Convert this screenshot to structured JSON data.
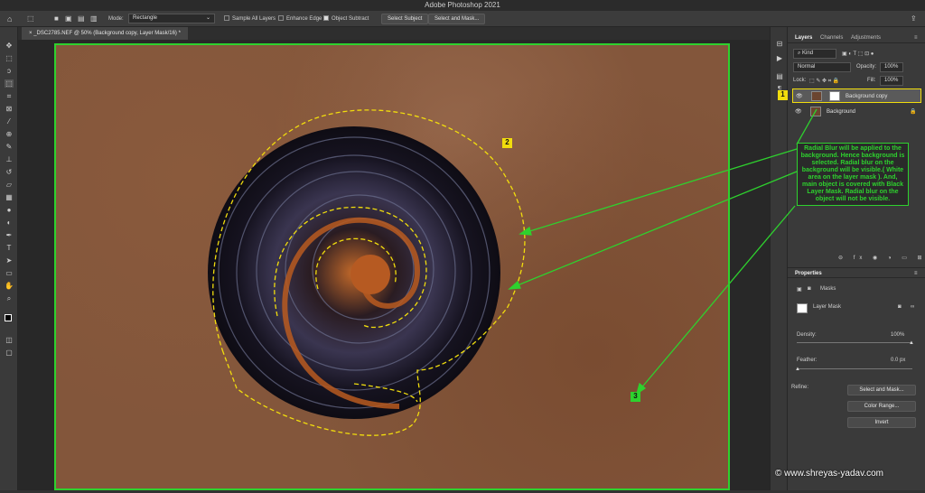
{
  "app": {
    "title": "Adobe Photoshop 2021"
  },
  "options_bar": {
    "mode_label": "Mode:",
    "mode_value": "Rectangle",
    "sample_all_layers": "Sample All Layers",
    "enhance_edge": "Enhance Edge",
    "object_subtract": "Object Subtract",
    "select_subject": "Select Subject",
    "select_and_mask": "Select and Mask..."
  },
  "document": {
    "tab_title": "_DSC2785.NEF @ 50% (Background copy, Layer Mask/16) *"
  },
  "layers_panel": {
    "tabs": [
      "Layers",
      "Channels",
      "Adjustments"
    ],
    "filter_kind": "Kind",
    "blend_mode": "Normal",
    "opacity_label": "Opacity:",
    "opacity_value": "100%",
    "lock_label": "Lock:",
    "fill_label": "Fill:",
    "fill_value": "100%",
    "layers": [
      {
        "name": "Background copy",
        "selected": true
      },
      {
        "name": "Background",
        "selected": false
      }
    ]
  },
  "properties_panel": {
    "title": "Properties",
    "section": "Masks",
    "mask_type": "Layer Mask",
    "density_label": "Density:",
    "density_value": "100%",
    "feather_label": "Feather:",
    "feather_value": "0.0 px",
    "refine_label": "Refine:",
    "select_and_mask": "Select and Mask...",
    "color_range": "Color Range...",
    "invert": "Invert"
  },
  "annotations": {
    "markers": [
      "1",
      "2",
      "3"
    ],
    "note": "Radial Blur will be applied to the background. Hence background is selected. Radial blur on the background will be visible.( White area on the layer mask ). And, main object is covered with Black Layer Mask. Radial blur on the object will not be visible.",
    "accent_green": "#2ed12e",
    "marker_yellow": "#f1dd0d"
  },
  "watermark": "© www.shreyas-yadav.com"
}
